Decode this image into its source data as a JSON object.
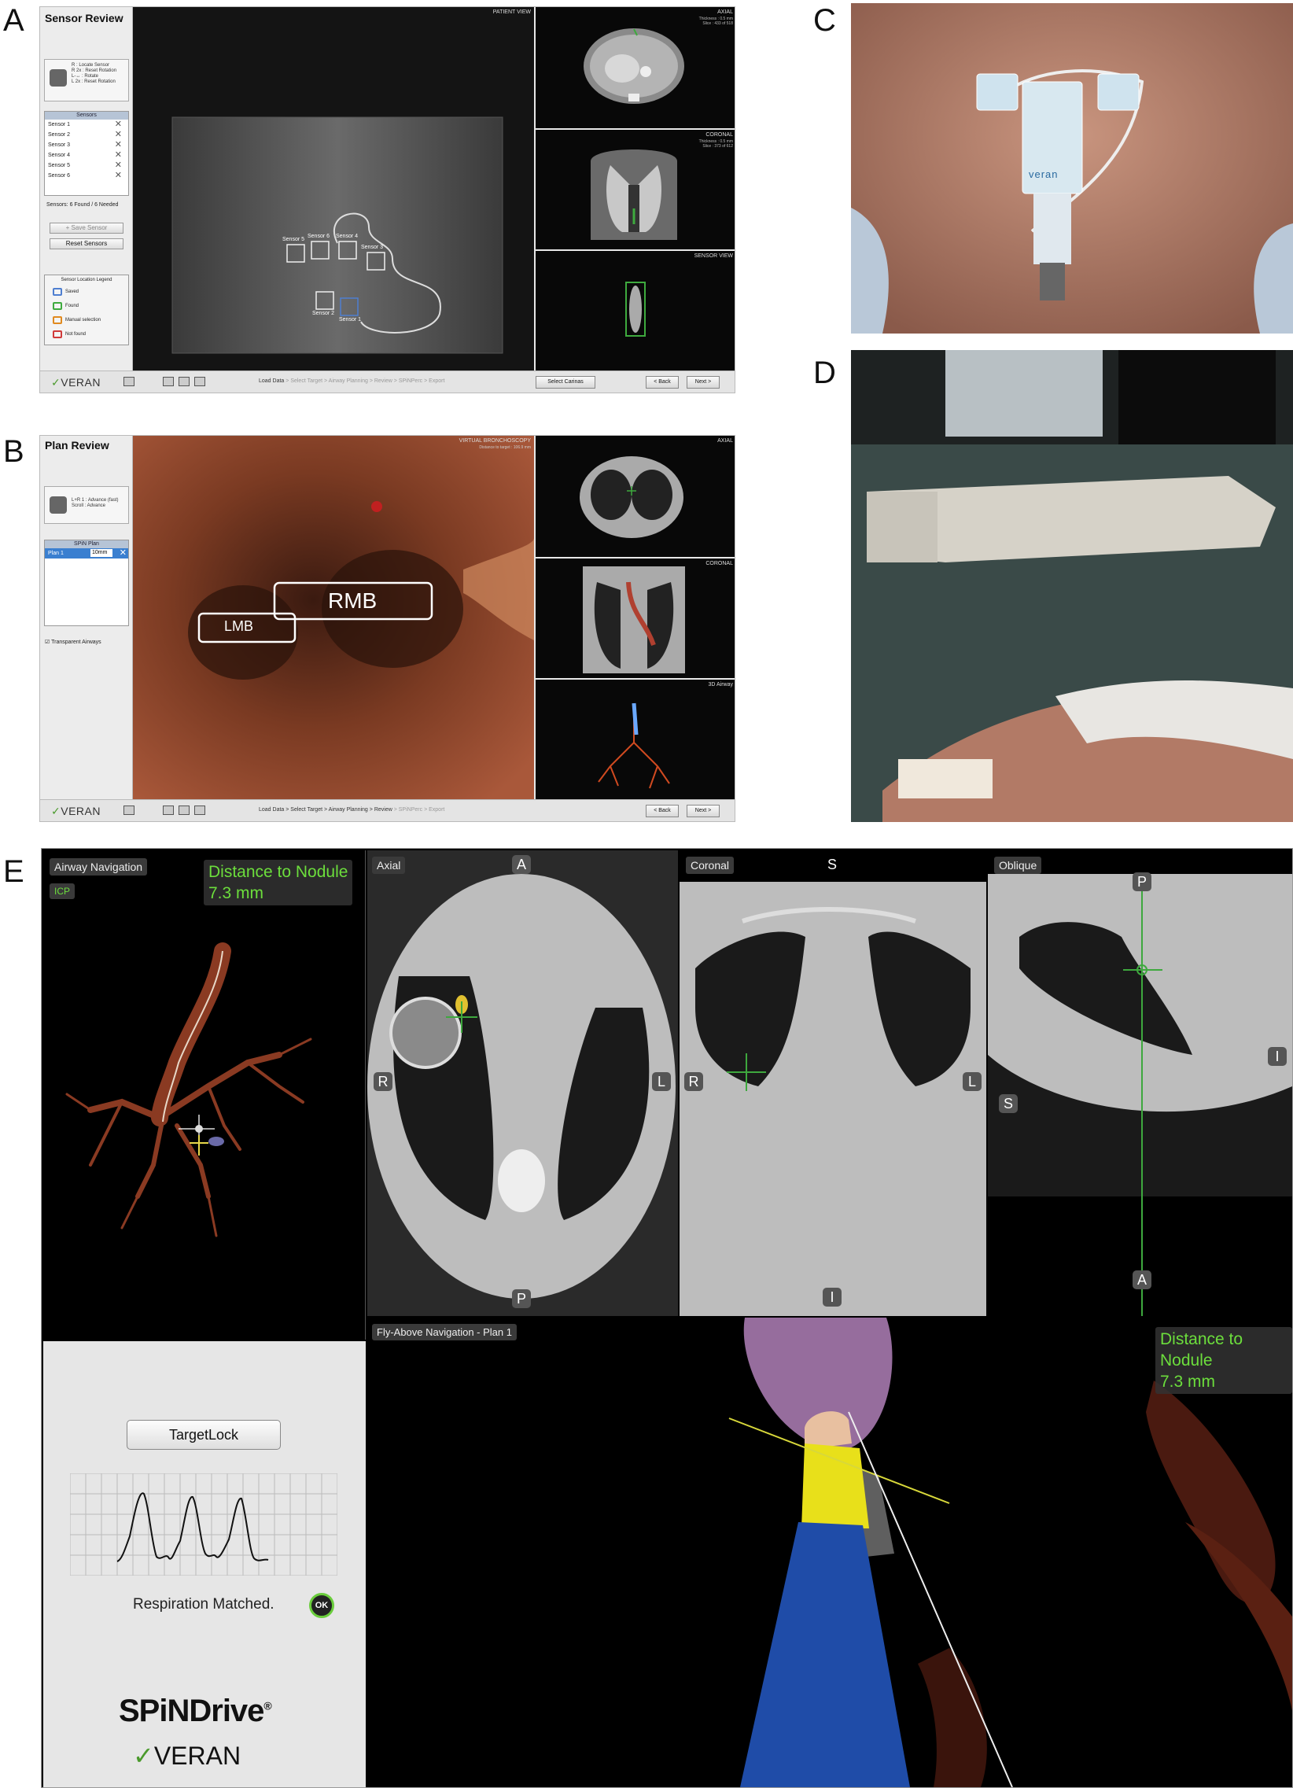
{
  "panel_letters": [
    "A",
    "B",
    "C",
    "D",
    "E"
  ],
  "panelA": {
    "title": "Sensor Review",
    "hints": [
      "R : Locate Sensor",
      "R 2x : Reset Rotation",
      "L-↔ : Rotate",
      "L 2x : Reset Rotation"
    ],
    "sensors_header": "Sensors",
    "sensors": [
      "Sensor 1",
      "Sensor 2",
      "Sensor 3",
      "Sensor 4",
      "Sensor 5",
      "Sensor 6"
    ],
    "sensor_status": "Sensors: 6 Found / 6 Needed",
    "save_sensor": "+ Save Sensor",
    "reset_sensors": "Reset Sensors",
    "legend_title": "Sensor Location Legend",
    "legend": [
      {
        "label": "Saved",
        "color": "#4f7fd0"
      },
      {
        "label": "Found",
        "color": "#3eaa3e"
      },
      {
        "label": "Manual selection",
        "color": "#e08a20"
      },
      {
        "label": "Not found",
        "color": "#d03a3a"
      }
    ],
    "main_view_label": "PATIENT VIEW",
    "sensor_tags": [
      "Sensor 5",
      "Sensor 6",
      "Sensor 4",
      "Sensor 3",
      "Sensor 2",
      "Sensor 1"
    ],
    "axial": {
      "label": "AXIAL",
      "info": [
        "Thickness : 0.5 mm",
        "Slice : 433 of 518"
      ]
    },
    "coronal": {
      "label": "CORONAL",
      "info": [
        "Thickness : 0.5 mm",
        "Slice : 373 of 612"
      ]
    },
    "sensor_view": "SENSOR VIEW",
    "workflow": [
      "Load Data",
      "Select Target",
      "Airway Planning",
      "Review",
      "SPiNPerc",
      "Export"
    ],
    "select_carinas": "Select Carinas",
    "back": "< Back",
    "next": "Next >",
    "logo": "VERAN"
  },
  "panelB": {
    "title": "Plan Review",
    "hints": [
      "L+R 1 : Advance (fast)",
      "Scroll : Advance"
    ],
    "plan_header": "SPiN Plan",
    "plan_row": "Plan 1",
    "plan_value": "10mm",
    "transparent_airways": "Transparent Airways",
    "main_view_label": "VIRTUAL BRONCHOSCOPY",
    "main_view_sub": "Distance to target : 106.9 mm",
    "label_rmb": "RMB",
    "label_lmb": "LMB",
    "axial": {
      "label": "AXIAL"
    },
    "coronal": {
      "label": "CORONAL"
    },
    "airway_3d": "3D Airway",
    "workflow": [
      "Load Data",
      "Select Target",
      "Airway Planning",
      "Review",
      "SPiNPerc",
      "Export"
    ],
    "back": "< Back",
    "next": "Next >",
    "logo": "VERAN"
  },
  "panelC": {
    "pad_text": "veran"
  },
  "panelE": {
    "airway_nav": "Airway Navigation",
    "icp": "ICP",
    "distance_label": "Distance to Nodule",
    "distance_value": "7.3 mm",
    "axial": {
      "label": "Axial",
      "top": "A",
      "bottom": "P",
      "left": "R",
      "right": "L"
    },
    "coronal": {
      "label": "Coronal",
      "top": "S",
      "bottom": "I",
      "left": "R",
      "right": "L"
    },
    "oblique": {
      "label": "Oblique",
      "top": "P",
      "bottom": "A",
      "left": "S",
      "right": "I"
    },
    "fly_above": "Fly-Above Navigation - Plan 1",
    "target_lock": "TargetLock",
    "respiration": "Respiration Matched.",
    "ok": "OK",
    "brand": "SPiNDrive",
    "brand_reg": "®",
    "logo": "VERAN"
  }
}
